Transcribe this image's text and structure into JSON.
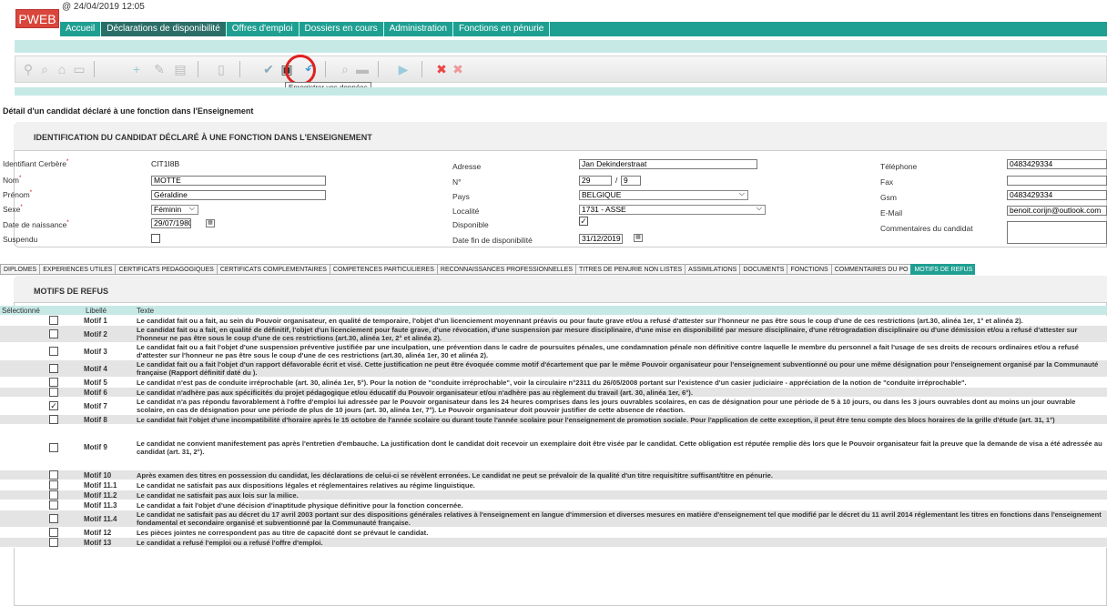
{
  "app": {
    "logo": "PWEB",
    "timestamp": "@ 24/04/2019 12:05"
  },
  "nav": [
    "Accueil",
    "Déclarations de disponibilité",
    "Offres d'emploi",
    "Dossiers en cours",
    "Administration",
    "Fonctions en pénurie"
  ],
  "toolbar": {
    "tooltip": "Enregistrer vos données"
  },
  "page_title": "Détail d'un candidat déclaré à une fonction dans l'Enseignement",
  "identification": {
    "header": "IDENTIFICATION DU CANDIDAT DÉCLARÉ À UNE FONCTION DANS L'ENSEIGNEMENT",
    "labels": {
      "cerbere": "Identifiant Cerbère",
      "nom": "Nom",
      "prenom": "Prénom",
      "sexe": "Sexe",
      "naissance": "Date de naissance",
      "suspendu": "Suspendu",
      "adresse": "Adresse",
      "numero": "N°",
      "pays": "Pays",
      "localite": "Localité",
      "disponible": "Disponible",
      "fin_dispo": "Date fin de disponibilité",
      "telephone": "Téléphone",
      "fax": "Fax",
      "gsm": "Gsm",
      "email": "E-Mail",
      "commentaires": "Commentaires du candidat"
    },
    "values": {
      "cerbere": "CIT1I8B",
      "nom": "MOTTE",
      "prenom": "Géraldine",
      "sexe": "Féminin",
      "naissance": "29/07/1980",
      "adresse": "Jan Dekinderstraat",
      "numero": "29",
      "boite": "9",
      "pays": "BELGIQUE",
      "localite": "1731 - ASSE",
      "fin_dispo": "31/12/2019",
      "telephone": "0483429334",
      "fax": "",
      "gsm": "0483429334",
      "email": "benoit.corijn@outlook.com",
      "commentaires": ""
    },
    "checked": {
      "suspendu": false,
      "disponible": true
    }
  },
  "tabs": [
    "DIPLOMES",
    "EXPERIENCES UTILES",
    "CERTIFICATS PEDAGOGIQUES",
    "CERTIFICATS COMPLEMENTAIRES",
    "COMPETENCES PARTICULIERES",
    "RECONNAISSANCES PROFESSIONNELLES",
    "TITRES DE PENURIE NON LISTES",
    "ASSIMILATIONS",
    "DOCUMENTS",
    "FONCTIONS",
    "COMMENTAIRES DU PO",
    "MOTIFS DE REFUS"
  ],
  "motifs": {
    "header": "MOTIFS DE REFUS",
    "columns": {
      "sel": "Sélectionné",
      "lib": "Libellé",
      "txt": "Texte"
    },
    "rows": [
      {
        "label": "Motif 1",
        "checked": false,
        "text": "Le candidat fait ou a fait, au sein du Pouvoir organisateur, en qualité de temporaire, l'objet d'un licenciement moyennant préavis ou pour faute grave et/ou a refusé d'attester sur l'honneur ne pas être sous le coup d'une de ces restrictions (art.30, alinéa 1er, 1° et alinéa 2)."
      },
      {
        "label": "Motif 2",
        "checked": false,
        "text": "Le candidat fait ou a fait, en qualité de définitif, l'objet d'un licenciement pour faute grave, d'une révocation, d'une suspension par mesure disciplinaire, d'une mise en disponibilité par mesure disciplinaire, d'une rétrogradation disciplinaire ou d'une démission et/ou a refusé d'attester sur l'honneur ne pas être sous le coup d'une de ces restrictions (art.30, alinéa 1er, 2° et alinéa 2)."
      },
      {
        "label": "Motif 3",
        "checked": false,
        "text": "Le candidat fait ou a fait l'objet d'une suspension préventive justifiée par une inculpation, une prévention dans le cadre de poursuites pénales, une condamnation pénale non définitive contre laquelle le membre du personnel a fait l'usage de ses droits de recours ordinaires et/ou a refusé d'attester sur l'honneur ne pas être sous le coup d'une de ces restrictions (art.30, alinéa 1er, 30 et alinéa 2)."
      },
      {
        "label": "Motif 4",
        "checked": false,
        "text": "Le candidat fait ou a fait l'objet d'un rapport défavorable écrit et visé. Cette justification ne peut être évoquée comme motif d'écartement que par le même Pouvoir organisateur pour l'enseignement subventionné ou pour une même désignation pour l'enseignement organisé par la Communauté française (Rapport définitif daté du )."
      },
      {
        "label": "Motif 5",
        "checked": false,
        "text": "Le candidat n'est pas de conduite irréprochable (art. 30, alinéa 1er, 5°). Pour la notion de \"conduite irréprochable\", voir la circulaire n°2311 du 26/05/2008 portant sur l'existence d'un casier judiciaire - appréciation de la notion de \"conduite irréprochable\"."
      },
      {
        "label": "Motif 6",
        "checked": false,
        "text": "Le candidat n'adhère pas aux spécificités du projet pédagogique et/ou éducatif du Pouvoir organisateur et/ou n'adhère pas au règlement du travail (art. 30, alinéa 1er, 6°)."
      },
      {
        "label": "Motif 7",
        "checked": true,
        "text": "Le candidat n'a pas répondu favorablement à l'offre d'emploi lui adressée par le Pouvoir organisateur dans les 24 heures comprises dans les jours ouvrables scolaires, en cas de désignation pour une période de 5 à 10 jours, ou dans les 3 jours ouvrables dont au moins un jour ouvrable scolaire, en cas de désignation pour une période de plus de 10 jours (art. 30, alinéa 1er, 7°). Le Pouvoir organisateur doit pouvoir justifier de cette absence de réaction."
      },
      {
        "label": "Motif 8",
        "checked": false,
        "text": "Le candidat fait l'objet d'une incompatibilité d'horaire après le 15 octobre de l'année scolaire ou durant toute l'année scolaire pour l'enseignement de promotion sociale. Pour l'application de cette exception, il peut être tenu compte des blocs horaires de la grille d'étude (art. 31, 1°)"
      },
      {
        "label": "Motif 9",
        "checked": false,
        "tall": true,
        "text": "Le candidat ne convient manifestement pas après l'entretien d'embauche. La justification dont le candidat doit recevoir un exemplaire doit être visée par le candidat. Cette obligation est réputée remplie dès lors que le Pouvoir organisateur fait la preuve que la demande de visa a été adressée au candidat (art. 31, 2°)."
      },
      {
        "label": "Motif 10",
        "checked": false,
        "text": "Après examen des titres en possession du candidat, les déclarations de celui-ci se révèlent erronées. Le candidat ne peut se prévaloir de la qualité d'un titre requis/titre suffisant/titre en pénurie."
      },
      {
        "label": "Motif 11.1",
        "checked": false,
        "text": "Le candidat ne satisfait pas aux dispositions légales et réglementaires relatives au régime linguistique."
      },
      {
        "label": "Motif 11.2",
        "checked": false,
        "text": "Le candidat ne satisfait pas aux lois sur la milice."
      },
      {
        "label": "Motif 11.3",
        "checked": false,
        "text": "Le candidat a fait l'objet d'une décision d'inaptitude physique définitive pour la fonction concernée."
      },
      {
        "label": "Motif 11.4",
        "checked": false,
        "text": "Le candidat ne satisfait pas au décret du 17 avril 2003 portant sur des dispositions générales relatives à l'enseignement en langue d'immersion et diverses mesures en matière d'enseignement tel que modifié par le décret du 11 avril 2014 réglementant les titres en fonctions dans l'enseignement fondamental et secondaire organisé et subventionné par la Communauté française."
      },
      {
        "label": "Motif 12",
        "checked": false,
        "text": "Les pièces jointes ne correspondent pas au titre de capacité dont se prévaut le candidat."
      },
      {
        "label": "Motif 13",
        "checked": false,
        "text": "Le candidat a refusé l'emploi ou a refusé l'offre d'emploi."
      }
    ]
  }
}
